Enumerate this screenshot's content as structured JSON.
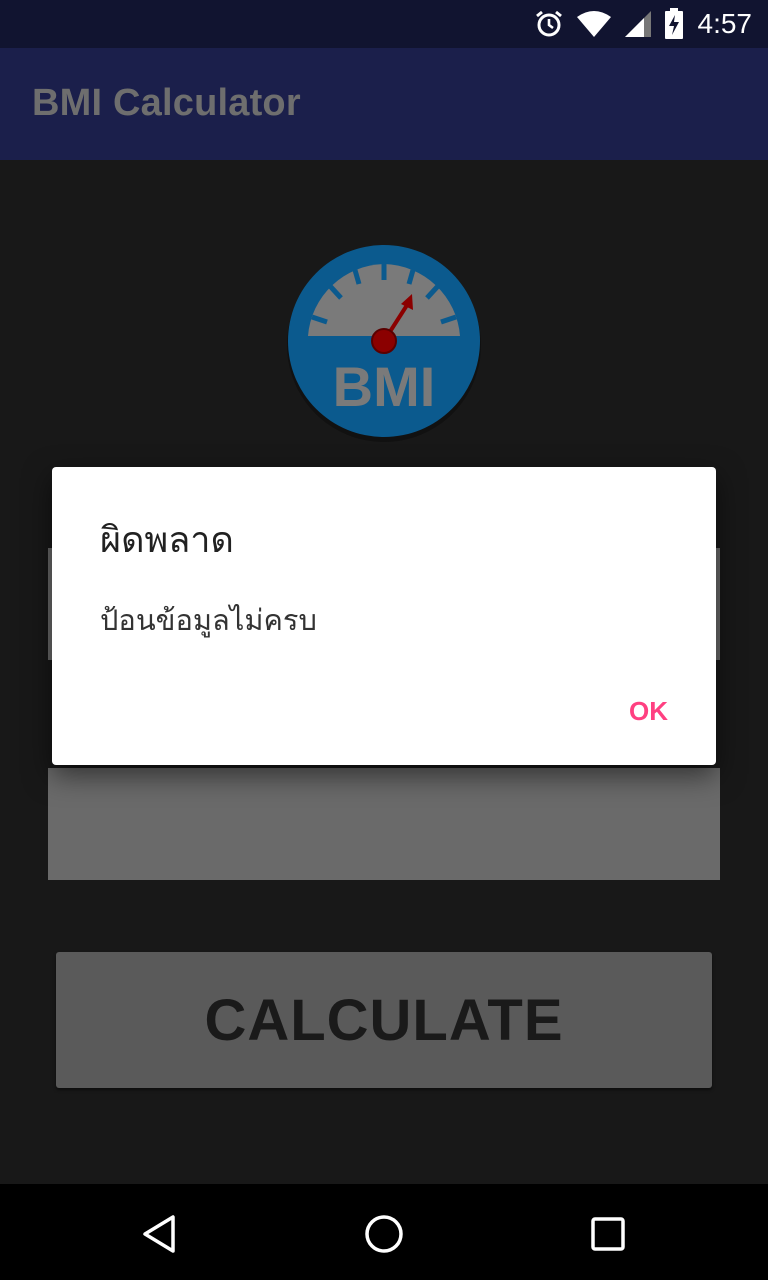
{
  "status_bar": {
    "time": "4:57",
    "icons": [
      "alarm-icon",
      "wifi-icon",
      "signal-icon",
      "battery-charging-icon"
    ]
  },
  "app_bar": {
    "title": "BMI Calculator"
  },
  "logo": {
    "text": "BMI",
    "icon": "gauge-icon",
    "colors": {
      "circle": "#0b5a8e",
      "gauge": "#7a7a7a",
      "needle": "#8b0000"
    }
  },
  "main": {
    "calculate_label": "CALCULATE"
  },
  "dialog": {
    "title": "ผิดพลาด",
    "message": "ป้อนข้อมูลไม่ครบ",
    "ok_label": "OK"
  },
  "nav_bar": {
    "icons": [
      "back-icon",
      "home-icon",
      "recent-apps-icon"
    ]
  },
  "colors": {
    "status_bar": "#111430",
    "app_bar": "#1b1f4b",
    "background": "#181818",
    "dialog_accent": "#ff4081"
  }
}
